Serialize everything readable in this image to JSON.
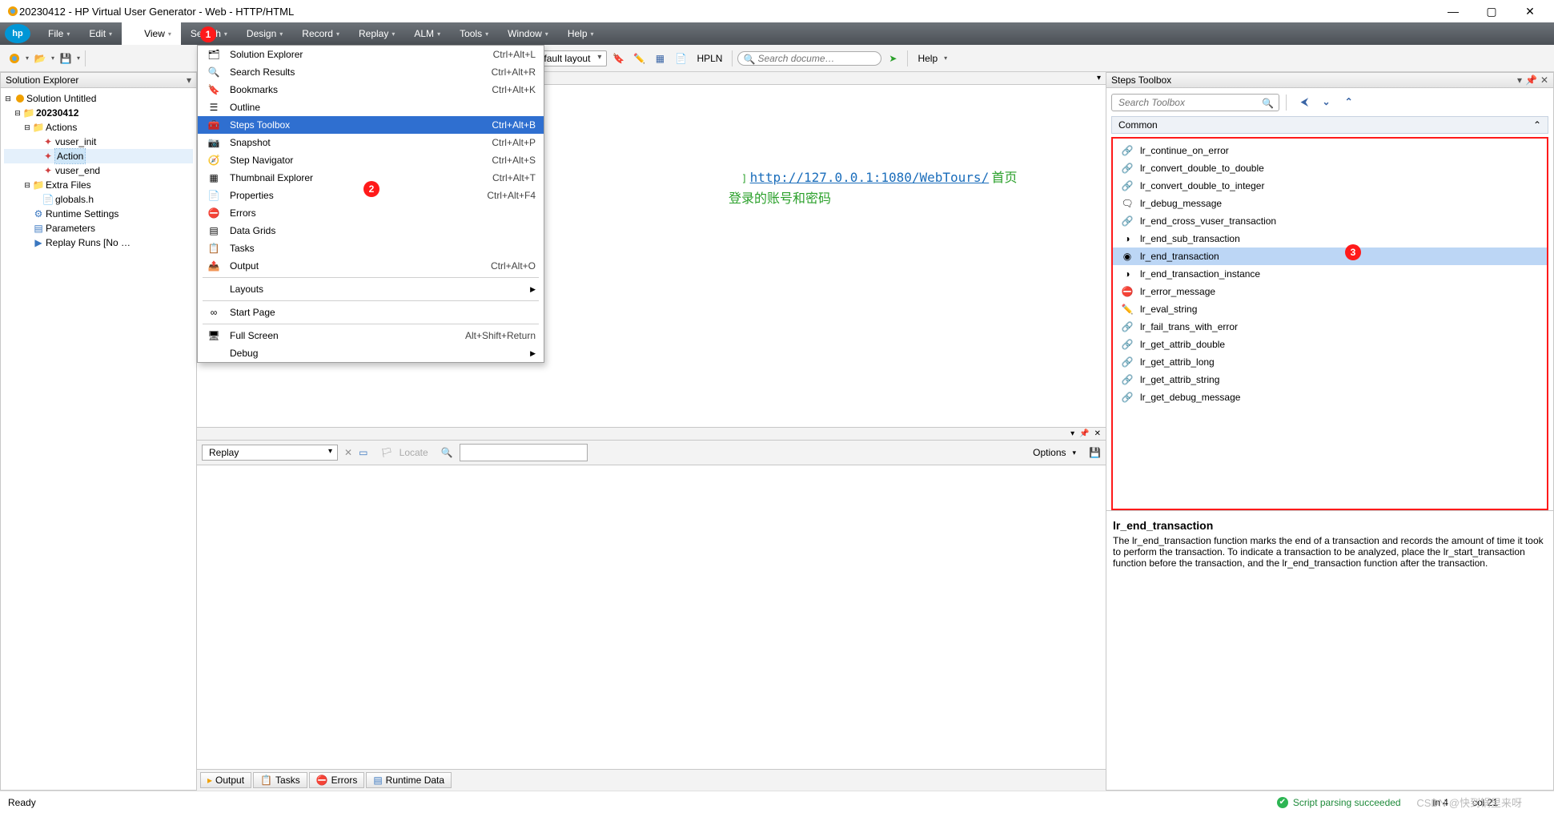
{
  "window": {
    "title": "20230412 - HP Virtual User Generator - Web - HTTP/HTML"
  },
  "menubar": [
    "File",
    "Edit",
    "View",
    "Search",
    "Design",
    "Record",
    "Replay",
    "ALM",
    "Tools",
    "Window",
    "Help"
  ],
  "toolbar": {
    "layout_combo": "Default layout",
    "hpln": "HPLN",
    "search_placeholder": "Search docume…",
    "help": "Help"
  },
  "view_menu": [
    {
      "icon": "🗂",
      "label": "Solution Explorer",
      "shortcut": "Ctrl+Alt+L"
    },
    {
      "icon": "🔍",
      "label": "Search Results",
      "shortcut": "Ctrl+Alt+R"
    },
    {
      "icon": "🔖",
      "label": "Bookmarks",
      "shortcut": "Ctrl+Alt+K"
    },
    {
      "icon": "☰",
      "label": "Outline",
      "shortcut": ""
    },
    {
      "icon": "🧰",
      "label": "Steps Toolbox",
      "shortcut": "Ctrl+Alt+B",
      "selected": true
    },
    {
      "icon": "📷",
      "label": "Snapshot",
      "shortcut": "Ctrl+Alt+P"
    },
    {
      "icon": "🧭",
      "label": "Step Navigator",
      "shortcut": "Ctrl+Alt+S"
    },
    {
      "icon": "▦",
      "label": "Thumbnail Explorer",
      "shortcut": "Ctrl+Alt+T"
    },
    {
      "icon": "📄",
      "label": "Properties",
      "shortcut": "Ctrl+Alt+F4"
    },
    {
      "icon": "⛔",
      "label": "Errors",
      "shortcut": ""
    },
    {
      "icon": "▤",
      "label": "Data Grids",
      "shortcut": ""
    },
    {
      "icon": "📋",
      "label": "Tasks",
      "shortcut": ""
    },
    {
      "icon": "📤",
      "label": "Output",
      "shortcut": "Ctrl+Alt+O"
    },
    {
      "sep": true
    },
    {
      "icon": "",
      "label": "Layouts",
      "shortcut": "",
      "sub": true
    },
    {
      "sep": true
    },
    {
      "icon": "∞",
      "label": "Start Page",
      "shortcut": ""
    },
    {
      "sep": true
    },
    {
      "icon": "🖥",
      "label": "Full Screen",
      "shortcut": "Alt+Shift+Return"
    },
    {
      "icon": "",
      "label": "Debug",
      "shortcut": "",
      "sub": true
    }
  ],
  "solution_explorer": {
    "title": "Solution Explorer",
    "tree": {
      "root": "Solution Untitled",
      "project": "20230412",
      "actions_folder": "Actions",
      "actions": [
        "vuser_init",
        "Action",
        "vuser_end"
      ],
      "extra_folder": "Extra Files",
      "extra": [
        "globals.h"
      ],
      "runtime": "Runtime Settings",
      "parameters": "Parameters",
      "replay_runs": "Replay Runs [No …"
    }
  },
  "editor": {
    "bracket": "]",
    "url": "http://127.0.0.1:1080/WebTours/",
    "comment_tail": " 首页",
    "comment_line2": "登录的账号和密码"
  },
  "replay_bar": {
    "combo": "Replay",
    "locate": "Locate",
    "options": "Options"
  },
  "footer_tabs": [
    "Output",
    "Tasks",
    "Errors",
    "Runtime Data"
  ],
  "steps_toolbox": {
    "title": "Steps Toolbox",
    "search_placeholder": "Search Toolbox",
    "group": "Common",
    "items": [
      "lr_continue_on_error",
      "lr_convert_double_to_double",
      "lr_convert_double_to_integer",
      "lr_debug_message",
      "lr_end_cross_vuser_transaction",
      "lr_end_sub_transaction",
      "lr_end_transaction",
      "lr_end_transaction_instance",
      "lr_error_message",
      "lr_eval_string",
      "lr_fail_trans_with_error",
      "lr_get_attrib_double",
      "lr_get_attrib_long",
      "lr_get_attrib_string",
      "lr_get_debug_message"
    ],
    "selected_index": 6,
    "desc_title": "lr_end_transaction",
    "desc_body": "The lr_end_transaction function marks the end of a transaction and records the amount of time it took to perform the transaction. To indicate a transaction to be analyzed, place the lr_start_transaction function before the transaction, and the lr_end_transaction function after the transaction."
  },
  "statusbar": {
    "ready": "Ready",
    "parse": "Script parsing succeeded",
    "line": "ln 4",
    "col": "col 21"
  },
  "watermark": "CSDN @快到锅里来呀",
  "badges": {
    "b1": "1",
    "b2": "2",
    "b3": "3"
  }
}
